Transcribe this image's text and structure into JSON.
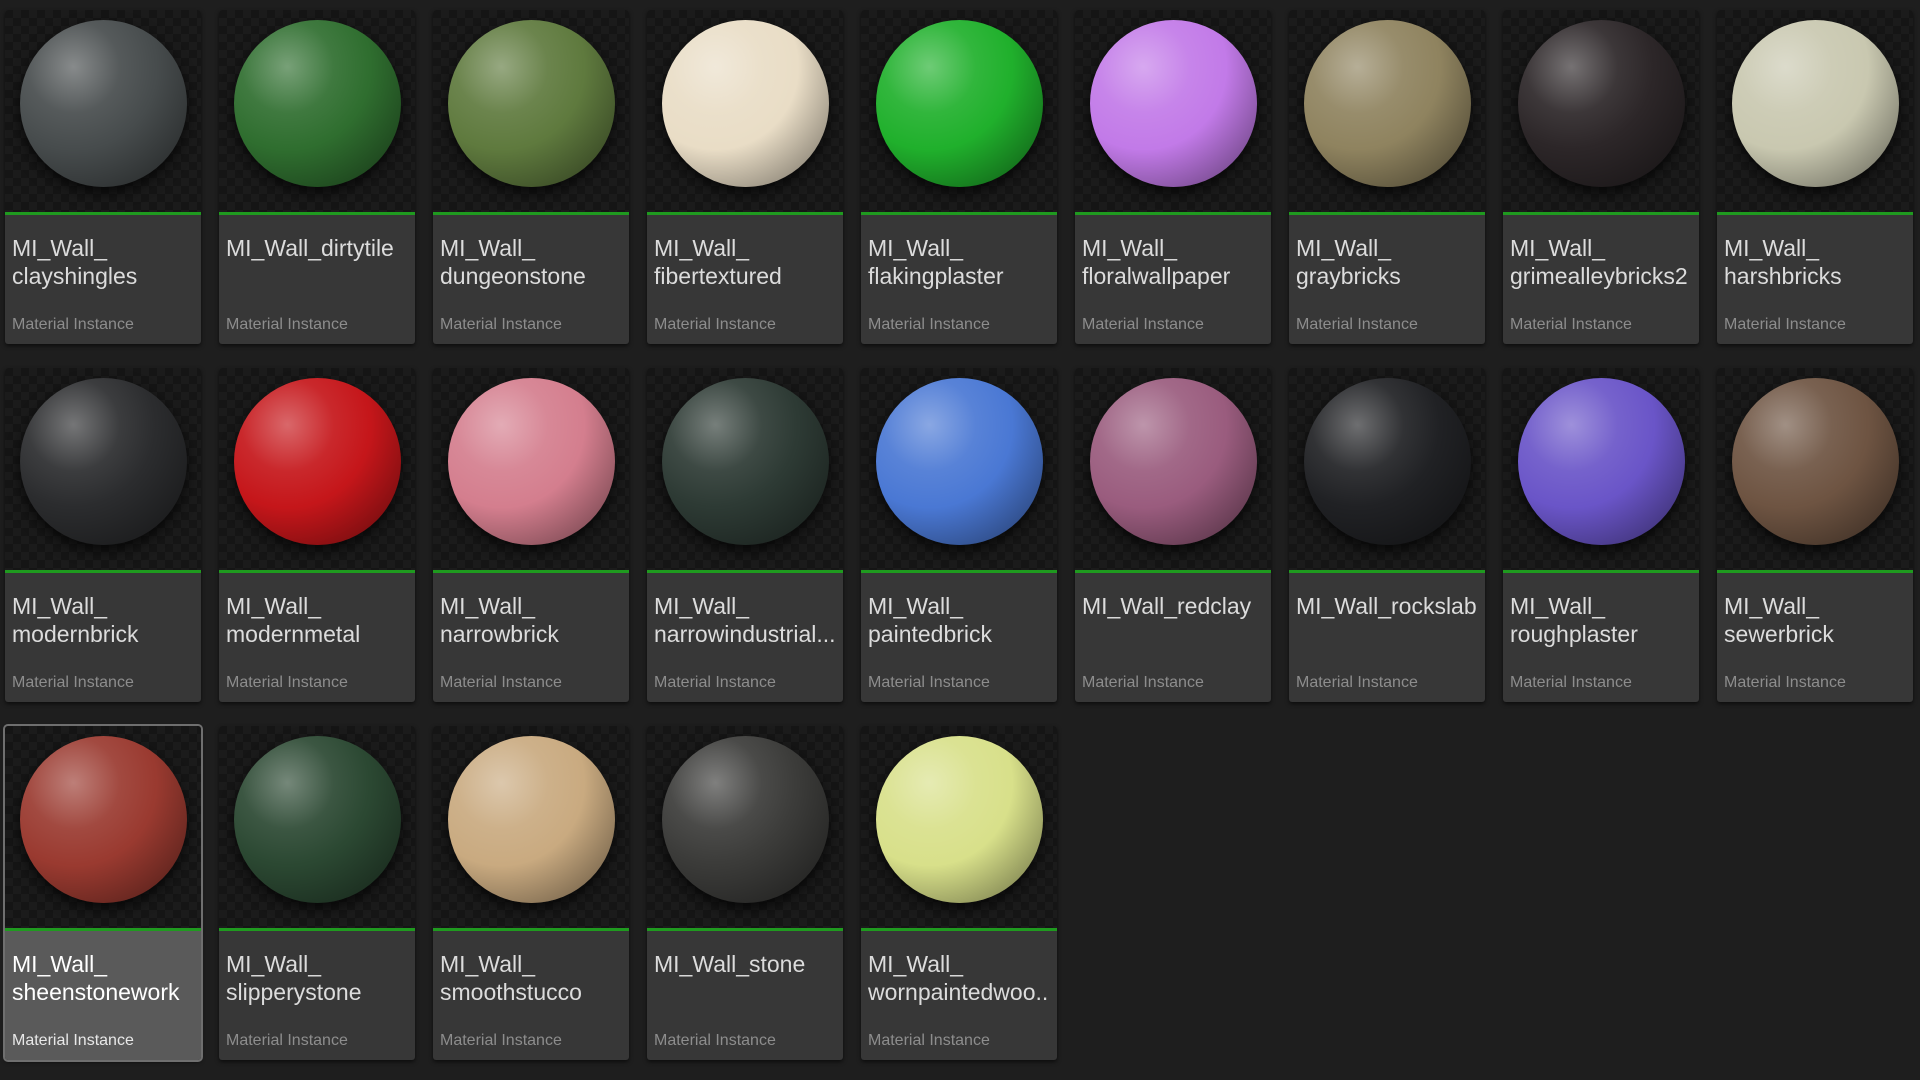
{
  "accent": "#1f9a1f",
  "type_label": "Material Instance",
  "assets": [
    {
      "line1": "MI_Wall_",
      "line2": "clayshingles",
      "color": "#474c4d",
      "selected": false
    },
    {
      "line1": "MI_Wall_dirtytile",
      "line2": "",
      "color": "#2f6e2f",
      "selected": false
    },
    {
      "line1": "MI_Wall_",
      "line2": "dungeonstone",
      "color": "#5f7a3e",
      "selected": false
    },
    {
      "line1": "MI_Wall_",
      "line2": "fibertextured",
      "color": "#e9ddc6",
      "selected": false
    },
    {
      "line1": "MI_Wall_",
      "line2": "flakingplaster",
      "color": "#20b02c",
      "selected": false
    },
    {
      "line1": "MI_Wall_",
      "line2": "floralwallpaper",
      "color": "#c27ae8",
      "selected": false
    },
    {
      "line1": "MI_Wall_",
      "line2": "graybricks",
      "color": "#8f835f",
      "selected": false
    },
    {
      "line1": "MI_Wall_",
      "line2": "grimealleybricks2",
      "color": "#2c2628",
      "selected": false
    },
    {
      "line1": "MI_Wall_",
      "line2": "harshbricks",
      "color": "#c9c8b0",
      "selected": false
    },
    {
      "line1": "MI_Wall_",
      "line2": "modernbrick",
      "color": "#2b2c2e",
      "selected": false
    },
    {
      "line1": "MI_Wall_",
      "line2": "modernmetal",
      "color": "#c5161a",
      "selected": false
    },
    {
      "line1": "MI_Wall_",
      "line2": "narrowbrick",
      "color": "#d47e8e",
      "selected": false
    },
    {
      "line1": "MI_Wall_",
      "line2": "narrowindustrial...",
      "color": "#2d3a34",
      "selected": false
    },
    {
      "line1": "MI_Wall_",
      "line2": "paintedbrick",
      "color": "#4a78d4",
      "selected": false
    },
    {
      "line1": "MI_Wall_redclay",
      "line2": "",
      "color": "#9a5c7e",
      "selected": false
    },
    {
      "line1": "MI_Wall_rockslab",
      "line2": "",
      "color": "#202124",
      "selected": false
    },
    {
      "line1": "MI_Wall_",
      "line2": "roughplaster",
      "color": "#6a55c8",
      "selected": false
    },
    {
      "line1": "MI_Wall_",
      "line2": "sewerbrick",
      "color": "#6e5442",
      "selected": false
    },
    {
      "line1": "MI_Wall_",
      "line2": "sheenstonework",
      "color": "#9a3a30",
      "selected": true
    },
    {
      "line1": "MI_Wall_",
      "line2": "slipperystone",
      "color": "#2b4832",
      "selected": false
    },
    {
      "line1": "MI_Wall_",
      "line2": "smoothstucco",
      "color": "#c9aa80",
      "selected": false
    },
    {
      "line1": "MI_Wall_stone",
      "line2": "",
      "color": "#3b3b39",
      "selected": false
    },
    {
      "line1": "MI_Wall_",
      "line2": "wornpaintedwoo...",
      "color": "#d8e08a",
      "selected": false
    }
  ]
}
